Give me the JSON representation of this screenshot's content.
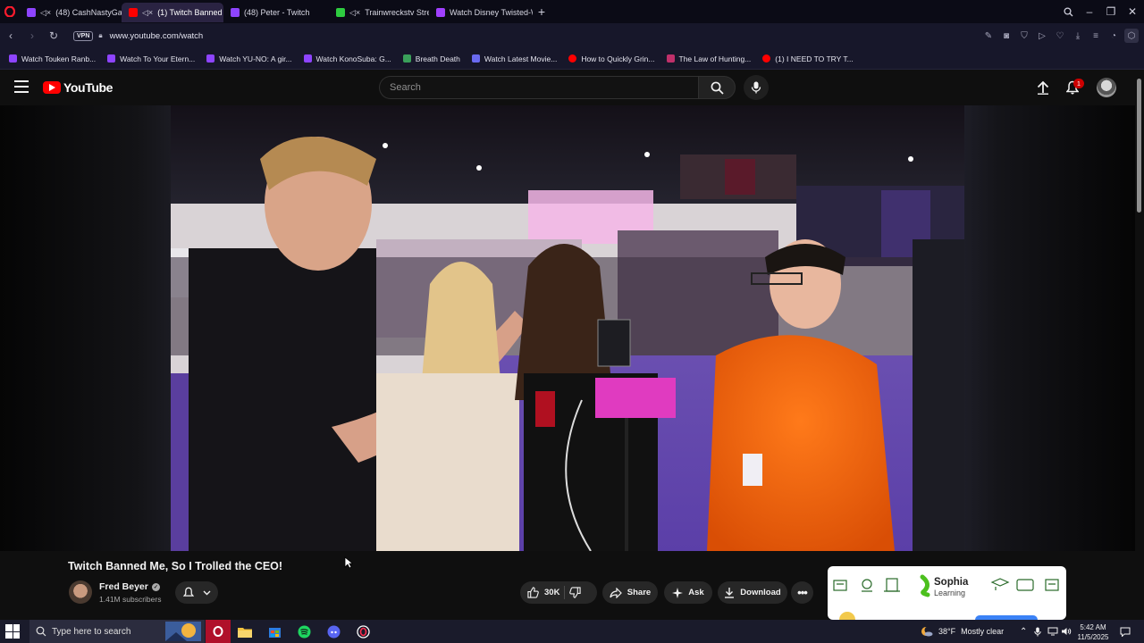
{
  "browser": {
    "tabs": [
      {
        "label": "(48) CashNastyGaming",
        "muted": true,
        "active": false,
        "fav_color": "#8e44ff"
      },
      {
        "label": "(1) Twitch Banned Me",
        "muted": true,
        "active": true,
        "fav_color": "#ff0000"
      },
      {
        "label": "(48) Peter - Twitch",
        "muted": false,
        "active": false,
        "fav_color": "#8e44ff"
      },
      {
        "label": "Trainwreckstv Stream",
        "muted": true,
        "active": false,
        "fav_color": "#2ecc40"
      },
      {
        "label": "Watch Disney Twisted-Wo",
        "muted": false,
        "active": false,
        "fav_color": "#a040ff"
      }
    ],
    "mute_glyph": "◁×",
    "new_tab_icon": "plus-icon",
    "url": "www.youtube.com/watch",
    "vpn_label": "VPN",
    "bookmarks": [
      {
        "label": "Watch Touken Ranb...",
        "color": "#8e44ff"
      },
      {
        "label": "Watch To Your Etern...",
        "color": "#8e44ff"
      },
      {
        "label": "Watch YU-NO: A gir...",
        "color": "#8e44ff"
      },
      {
        "label": "Watch KonoSuba: G...",
        "color": "#8e44ff"
      },
      {
        "label": "Breath Death",
        "color": "#3aa05a"
      },
      {
        "label": "Watch Latest Movie...",
        "color": "#6a6af0"
      },
      {
        "label": "How to Quickly Grin...",
        "color": "#ff0000"
      },
      {
        "label": "The Law of Hunting...",
        "color": "#c0306a"
      },
      {
        "label": "(1) I NEED TO TRY T...",
        "color": "#ff0000"
      }
    ]
  },
  "youtube": {
    "logo_text": "YouTube",
    "search_placeholder": "Search",
    "notification_count": "1",
    "video": {
      "title": "Twitch Banned Me, So I Trolled the CEO!",
      "channel": "Fred Beyer",
      "subscribers": "1.41M subscribers",
      "likes": "30K",
      "share_label": "Share",
      "ask_label": "Ask",
      "download_label": "Download"
    },
    "ad": {
      "brand": "Sophia",
      "subtitle": "Learning"
    }
  },
  "taskbar": {
    "search_placeholder": "Type here to search",
    "weather_temp": "38°F",
    "weather_text": "Mostly clear",
    "time": "5:42 AM",
    "date": "11/5/2025"
  },
  "colors": {
    "youtube_red": "#ff0000",
    "browser_tab_active": "#2a2342",
    "page_background": "#0f0f0f"
  }
}
